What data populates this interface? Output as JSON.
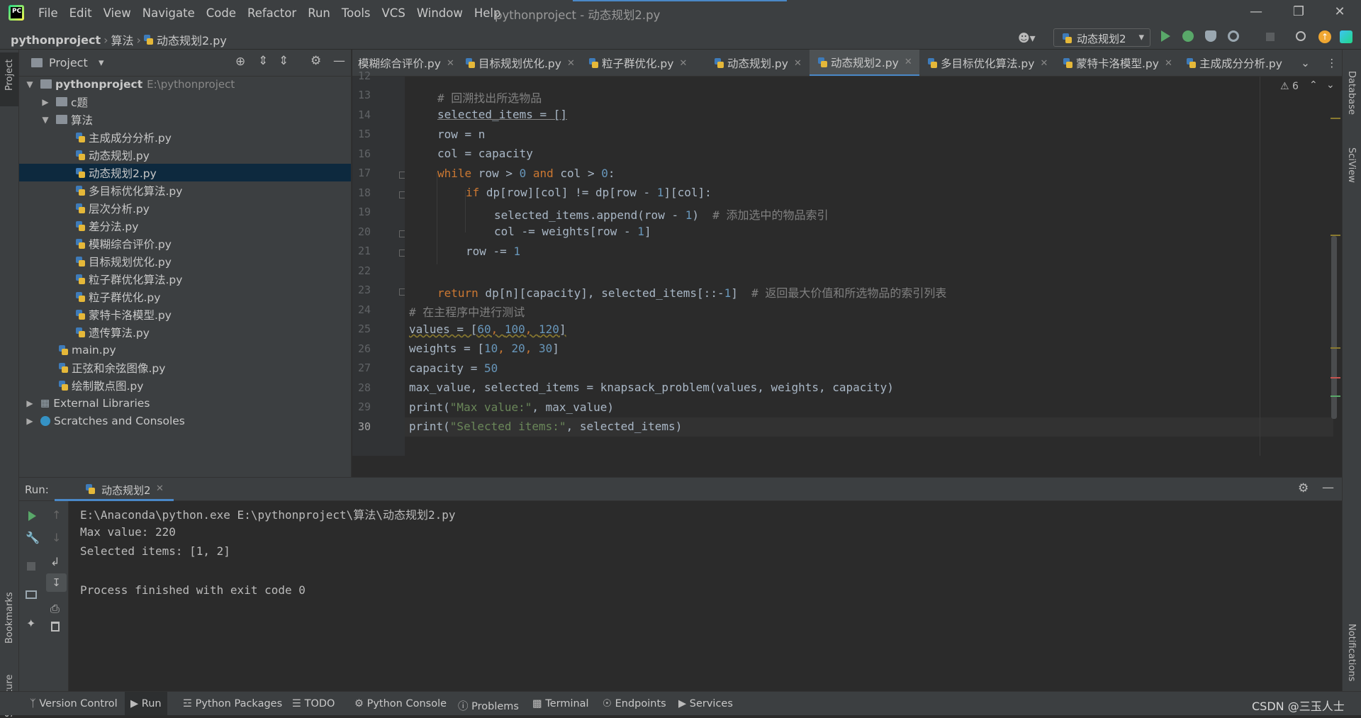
{
  "menu": [
    "File",
    "Edit",
    "View",
    "Navigate",
    "Code",
    "Refactor",
    "Run",
    "Tools",
    "VCS",
    "Window",
    "Help"
  ],
  "window_title": "pythonproject - 动态规划2.py",
  "breadcrumb": {
    "project": "pythonproject",
    "folder": "算法",
    "file": "动态规划2.py"
  },
  "run_config": "动态规划2",
  "left_strip": {
    "project": "Project",
    "bookmarks": "Bookmarks",
    "structure": "Structure"
  },
  "right_strip": {
    "database": "Database",
    "sciview": "SciView",
    "notifications": "Notifications"
  },
  "project_panel": {
    "title": "Project",
    "tree": [
      {
        "label": "pythonproject",
        "extra": "E:\\pythonproject"
      },
      {
        "label": "c题"
      },
      {
        "label": "算法"
      },
      {
        "label": "主成成分分析.py"
      },
      {
        "label": "动态规划.py"
      },
      {
        "label": "动态规划2.py"
      },
      {
        "label": "多目标优化算法.py"
      },
      {
        "label": "层次分析.py"
      },
      {
        "label": "差分法.py"
      },
      {
        "label": "模糊综合评价.py"
      },
      {
        "label": "目标规划优化.py"
      },
      {
        "label": "粒子群优化算法.py"
      },
      {
        "label": "粒子群优化.py"
      },
      {
        "label": "蒙特卡洛模型.py"
      },
      {
        "label": "遗传算法.py"
      },
      {
        "label": "main.py"
      },
      {
        "label": "正弦和余弦图像.py"
      },
      {
        "label": "绘制散点图.py"
      },
      {
        "label": "External Libraries"
      },
      {
        "label": "Scratches and Consoles"
      }
    ]
  },
  "tabs": [
    "模糊综合评价.py",
    "目标规划优化.py",
    "粒子群优化.py",
    "动态规划.py",
    "动态规划2.py",
    "多目标优化算法.py",
    "蒙特卡洛模型.py",
    "主成成分分析.py"
  ],
  "inspection_count": "6",
  "line_numbers": [
    "12",
    "13",
    "14",
    "15",
    "16",
    "17",
    "18",
    "19",
    "20",
    "21",
    "22",
    "23",
    "24",
    "25",
    "26",
    "27",
    "28",
    "29",
    "30"
  ],
  "code_lines": {
    "l13": "# 回溯找出所选物品",
    "l14": "selected_items = []",
    "l15": "row = n",
    "l16": "col = capacity",
    "l17_kw": "while",
    "l17_a": " row > ",
    "l17_n1": "0",
    "l17_and": " and",
    "l17_b": " col > ",
    "l17_n2": "0",
    "l17_c": ":",
    "l18_kw": "if",
    "l18_a": " dp[row][col] != dp[row - ",
    "l18_n": "1",
    "l18_b": "][col]:",
    "l19_a": "selected_items.append(row - ",
    "l19_n": "1",
    "l19_b": ")  ",
    "l19_c": "# 添加选中的物品索引",
    "l20_a": "col -= weights[row - ",
    "l20_n": "1",
    "l20_b": "]",
    "l21_a": "row -= ",
    "l21_n": "1",
    "l23_kw": "return",
    "l23_a": " dp[n][capacity], selected_items[::-",
    "l23_n": "1",
    "l23_b": "]  ",
    "l23_c": "# 返回最大价值和所选物品的索引列表",
    "l24": "# 在主程序中进行测试",
    "l25_a": "values = [",
    "l25_n1": "60",
    "l25_s1": ", ",
    "l25_n2": "100",
    "l25_s2": ", ",
    "l25_n3": "120",
    "l25_b": "]",
    "l26_a": "weights = [",
    "l26_n1": "10",
    "l26_s1": ", ",
    "l26_n2": "20",
    "l26_s2": ", ",
    "l26_n3": "30",
    "l26_b": "]",
    "l27_a": "capacity = ",
    "l27_n": "50",
    "l28": "max_value, selected_items = knapsack_problem(values, weights, capacity)",
    "l29_a": "print(",
    "l29_s": "\"Max value:\"",
    "l29_b": ", max_value)",
    "l30_a": "print(",
    "l30_s": "\"Selected items:\"",
    "l30_b": ", selected_items)"
  },
  "run_panel": {
    "label": "Run:",
    "tab": "动态规划2",
    "output": [
      "E:\\Anaconda\\python.exe E:\\pythonproject\\算法\\动态规划2.py",
      "Max value: 220",
      "Selected items: [1, 2]",
      "",
      "Process finished with exit code 0"
    ]
  },
  "bottom_tools": [
    "Version Control",
    "Run",
    "Python Packages",
    "TODO",
    "Python Console",
    "Problems",
    "Terminal",
    "Endpoints",
    "Services"
  ],
  "watermark": "CSDN @三玉人士",
  "colors": {
    "keyword": "#cc7832",
    "number": "#6897bb",
    "comment": "#808080",
    "string": "#6a8759",
    "text": "#a9b7c6",
    "accent": "#4a88c7",
    "run_green": "#59a869"
  }
}
